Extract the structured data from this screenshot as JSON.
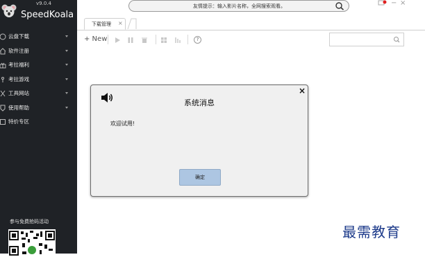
{
  "app": {
    "version": "v9.0.4",
    "brand": "SpeedKoala"
  },
  "sidebar": {
    "items": [
      {
        "label": "云盘下载",
        "icon": "cloud-icon",
        "expandable": true
      },
      {
        "label": "软件注册",
        "icon": "home-icon",
        "expandable": true
      },
      {
        "label": "考拉福利",
        "icon": "gift-icon",
        "expandable": true
      },
      {
        "label": "考拉游戏",
        "icon": "game-icon",
        "expandable": true
      },
      {
        "label": "工具网站",
        "icon": "tools-icon",
        "expandable": true
      },
      {
        "label": "使用帮助",
        "icon": "help-icon",
        "expandable": true
      },
      {
        "label": "特价专区",
        "icon": "tag-icon",
        "expandable": false
      }
    ],
    "promo_text": "参与免费抢码活动"
  },
  "top_search": {
    "placeholder": "友情提示：输入影片名称，全网搜索观看。"
  },
  "window_controls": {
    "minimize": "−",
    "close": "×"
  },
  "tabs": [
    {
      "label": "下载管理",
      "close": "×",
      "active": true
    }
  ],
  "toolbar": {
    "new_label": "+ New",
    "help": "?"
  },
  "dialog": {
    "title": "系统消息",
    "close": "×",
    "message": "欢迎试用!",
    "ok_label": "确定"
  },
  "watermark": "最需教育",
  "colors": {
    "sidebar_bg": "#1f2226",
    "dialog_bg": "#f0f0f0",
    "ok_button": "#adc6e2",
    "watermark": "#1c3a8a",
    "notification_dot": "#e02020"
  }
}
